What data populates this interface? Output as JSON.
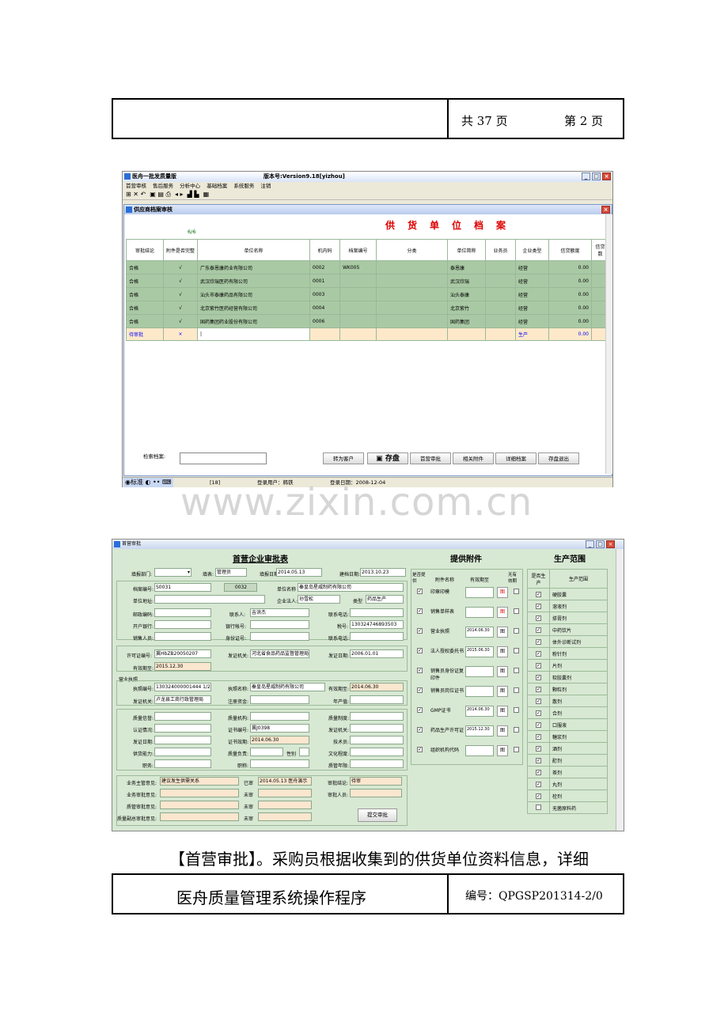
{
  "header": {
    "pages_total": "共 37 页",
    "page_current": "第 2 页"
  },
  "app1": {
    "title": "医舟一批发质量版",
    "version": "版本号:Version9.18[yizhou]",
    "menu": [
      "首营审核",
      "售后服务",
      "分析中心",
      "基础档案",
      "系统服务",
      "注销"
    ],
    "inner_title": "供应商档案审核",
    "big_title": "供货单位档案",
    "count": "6/6",
    "columns": [
      "审批结论",
      "附件是否完整",
      "单位名称",
      "机内码",
      "档案编号",
      "分类",
      "单位简称",
      "业务员",
      "企业类型",
      "信贷额度",
      "信贷数"
    ],
    "rows": [
      [
        "合格",
        "√",
        "广东泰恩康药业有限公司",
        "0002",
        "WK005",
        "",
        "泰恩康",
        "",
        "经营",
        "0.00"
      ],
      [
        "合格",
        "√",
        "武汉欣瑞医药有限公司",
        "0001",
        "",
        "",
        "武汉欣瑞",
        "",
        "经营",
        "0.00"
      ],
      [
        "合格",
        "√",
        "汕头市泰康药品有限公司",
        "0003",
        "",
        "",
        "汕头泰康",
        "",
        "经营",
        "0.00"
      ],
      [
        "合格",
        "√",
        "北京紫竹医药经营有限公司",
        "0004",
        "",
        "",
        "北京紫竹",
        "",
        "经营",
        "0.00"
      ],
      [
        "合格",
        "√",
        "国药集团药业股份有限公司",
        "0006",
        "",
        "",
        "国药集团",
        "",
        "经营",
        "0.00"
      ]
    ],
    "pending_row": [
      "待审批",
      "×",
      "|",
      "",
      "",
      "",
      "",
      "",
      "生产",
      "0.00"
    ],
    "search_label": "检索档案:",
    "buttons": [
      "转为客户",
      "存盘",
      "首营审批",
      "相关附件",
      "详细档案",
      "存盘退出"
    ],
    "status": {
      "ime": "标准",
      "count": "[18]",
      "user": "登录用户：韩铁",
      "date": "登录日期：2008-12-04"
    }
  },
  "watermark": "www.zixin.com.cn",
  "app2": {
    "window_title": "首营审批",
    "section1": "首营企业审批表",
    "section2": "提供附件",
    "section3": "生产范围",
    "fields": {
      "dept_label": "填报部门:",
      "filler_label": "填表:",
      "filler": "管理员",
      "fill_date_label": "填报日期:",
      "fill_date": "2014.05.13",
      "create_date_label": "建档日期:",
      "create_date": "2013.10.23",
      "archive_no_label": "档案编号:",
      "archive_no": "S0031",
      "code": "0032",
      "unit_name_label": "单位名称",
      "unit_name": "秦皇岛星威制药有限公司",
      "address_label": "单位地址:",
      "legal_label": "企业法人:",
      "legal": "孙雪松",
      "type_label": "类型",
      "type": "药品生产",
      "zip_label": "邮政编码:",
      "contact_label": "联系人:",
      "contact": "吉洪杰",
      "phone_label": "联系电话:",
      "bank_label": "开户银行:",
      "account_label": "银行帐号:",
      "tax_label": "税号:",
      "tax": "130324746893503",
      "sales_label": "销售人员:",
      "id_label": "身份证号:",
      "phone2_label": "联系电话:",
      "license_label": "许可证编号:",
      "license": "冀HbZB20050207",
      "issuer_label": "发证机关:",
      "issuer": "河北省食品药品监督管理局",
      "issue_date_label": "发证日期:",
      "issue_date": "2006.01.01",
      "valid_label": "有效期至:",
      "valid": "2015.12.30",
      "biz_section": "营业执照",
      "biz_no_label": "执照编号:",
      "biz_no": "130324000001444 1/2",
      "biz_name_label": "执照名称:",
      "biz_name": "秦皇岛星威制药有限公司",
      "biz_valid_label": "有效期至:",
      "biz_valid": "2014.06.30",
      "biz_issuer_label": "发证机关:",
      "biz_issuer": "卢龙县工商行政管理局",
      "capital_label": "注册资金:",
      "annual_label": "年产值:",
      "qa_label": "质量信誉:",
      "qa_org_label": "质量机构:",
      "qa_sys_label": "质量制度:",
      "cert_label": "认证情况:",
      "cert_no_label": "证书编号:",
      "cert_no": "冀J0398",
      "cert_org_label": "发证机关:",
      "cert_date_label": "发证日期:",
      "cert_valid_label": "证书效期:",
      "cert_valid": "2014.06.30",
      "tech_label": "技术员:",
      "supply_label": "供货能力:",
      "qa_person_label": "质量负责:",
      "gender_label": "性别",
      "edu_label": "文化程度:",
      "duty_label": "职务:",
      "title_label": "职称:",
      "qa_years_label": "质管年限:",
      "biz_opinion_label": "业务主管意见:",
      "biz_opinion": "建议发生供需关系",
      "signed": "已审",
      "signed_info": "2014.05.13 医舟演示",
      "approval_label": "审批结论:",
      "approval": "待审",
      "biz_review_label": "业务审批意见:",
      "unsigned1": "未审",
      "approver_label": "审批人员:",
      "qa_review_label": "质管审批意见:",
      "unsigned2": "未审",
      "qa_vice_label": "质量副总审批意见:",
      "unsigned3": "未审",
      "submit": "提交审批"
    },
    "attach_headers": [
      "是否提供",
      "附件名称",
      "有效期至",
      "",
      "无有效期"
    ],
    "attachments": [
      {
        "name": "印章印模",
        "date": "",
        "icon": "图"
      },
      {
        "name": "销售单样表",
        "date": "",
        "icon": "图"
      },
      {
        "name": "营业执照",
        "date": "2014.06.30",
        "icon": "图"
      },
      {
        "name": "法人授权委托书",
        "date": "2015.06.30",
        "icon": "图"
      },
      {
        "name": "销售员身份证复印件",
        "date": "",
        "icon": "图"
      },
      {
        "name": "销售员岗位证书",
        "date": "",
        "icon": "图"
      },
      {
        "name": "GMP证书",
        "date": "2014.06.30",
        "icon": "图"
      },
      {
        "name": "药品生产许可证",
        "date": "2015.12.30",
        "icon": "图"
      },
      {
        "name": "组织机构代码",
        "date": "",
        "icon": "图"
      }
    ],
    "scope_headers": [
      "是否生产",
      "生产范围"
    ],
    "scope": [
      "硬胶囊",
      "溶液剂",
      "搽膏剂",
      "中药饮片",
      "体外诊断试剂",
      "粉针剂",
      "片剂",
      "软胶囊剂",
      "颗粒剂",
      "散剂",
      "合剂",
      "口服液",
      "糖浆剂",
      "酒剂",
      "酊剂",
      "茶剂",
      "丸剂",
      "栓剂",
      "无菌原料药"
    ]
  },
  "paragraph": "【首营审批】。采购员根据收集到的供货单位资料信息，详细",
  "footer": {
    "title": "医舟质量管理系统操作程序",
    "code": "编号：QPGSP201314-2/0"
  }
}
